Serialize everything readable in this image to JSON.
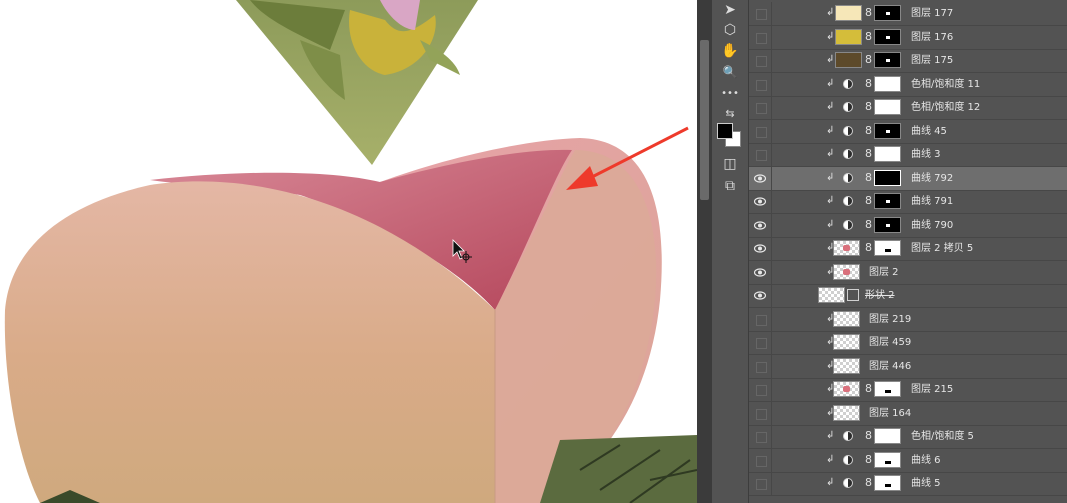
{
  "canvas": {
    "description_free": true
  },
  "colors": {
    "panel_bg": "#535353",
    "row_selected": "#6e6e6e",
    "annotation_arrow": "#ee3a2b"
  },
  "toolbar": {
    "tools": [
      {
        "icon": "move-arrow-icon",
        "glyph": "➤"
      },
      {
        "icon": "hexagon-shape-icon",
        "glyph": "⬡"
      },
      {
        "icon": "hand-icon",
        "glyph": "✋"
      },
      {
        "icon": "zoom-icon",
        "glyph": "🔍"
      },
      {
        "icon": "more-tools-icon",
        "glyph": "•••"
      },
      {
        "icon": "swap-colors-icon",
        "glyph": "⇆"
      },
      {
        "icon": "quick-mask-icon",
        "glyph": "◫"
      },
      {
        "icon": "screen-mode-icon",
        "glyph": "⧉"
      }
    ],
    "foreground_color": "#000000",
    "background_color": "#ffffff"
  },
  "layers": [
    {
      "name": "图层 177",
      "visible": false,
      "thumb": "#f6e7b8",
      "type": "fill",
      "mask": "dot"
    },
    {
      "name": "图层 176",
      "visible": false,
      "thumb": "#d4bd3a",
      "type": "fill",
      "mask": "dot"
    },
    {
      "name": "图层 175",
      "visible": false,
      "thumb": "#5d4a2a",
      "type": "fill",
      "mask": "dot"
    },
    {
      "name": "色相/饱和度 11",
      "visible": false,
      "type": "adjustment",
      "mask": "white"
    },
    {
      "name": "色相/饱和度 12",
      "visible": false,
      "type": "adjustment",
      "mask": "white"
    },
    {
      "name": "曲线 45",
      "visible": false,
      "type": "adjustment",
      "mask": "dot"
    },
    {
      "name": "曲线 3",
      "visible": false,
      "type": "adjustment",
      "mask": "white"
    },
    {
      "name": "曲线 792",
      "visible": true,
      "type": "adjustment",
      "mask": "black",
      "selected": true
    },
    {
      "name": "曲线 791",
      "visible": true,
      "type": "adjustment",
      "mask": "dot"
    },
    {
      "name": "曲线 790",
      "visible": true,
      "type": "adjustment",
      "mask": "dot"
    },
    {
      "name": "图层 2 拷贝 5",
      "visible": true,
      "type": "pixel-masked",
      "mask": "white-dot"
    },
    {
      "name": "图层 2",
      "visible": true,
      "type": "pixel"
    },
    {
      "name": "形状 2",
      "visible": true,
      "type": "shape"
    },
    {
      "name": "图层 219",
      "visible": false,
      "type": "pixel"
    },
    {
      "name": "图层 459",
      "visible": false,
      "type": "pixel"
    },
    {
      "name": "图层 446",
      "visible": false,
      "type": "pixel"
    },
    {
      "name": "图层 215",
      "visible": false,
      "type": "pixel-masked",
      "mask": "white-dot"
    },
    {
      "name": "图层 164",
      "visible": false,
      "type": "pixel"
    },
    {
      "name": "色相/饱和度 5",
      "visible": false,
      "type": "adjustment",
      "mask": "white"
    },
    {
      "name": "曲线 6",
      "visible": false,
      "type": "adjustment",
      "mask": "white-dot"
    },
    {
      "name": "曲线 5",
      "visible": false,
      "type": "adjustment",
      "mask": "white-dot"
    }
  ]
}
